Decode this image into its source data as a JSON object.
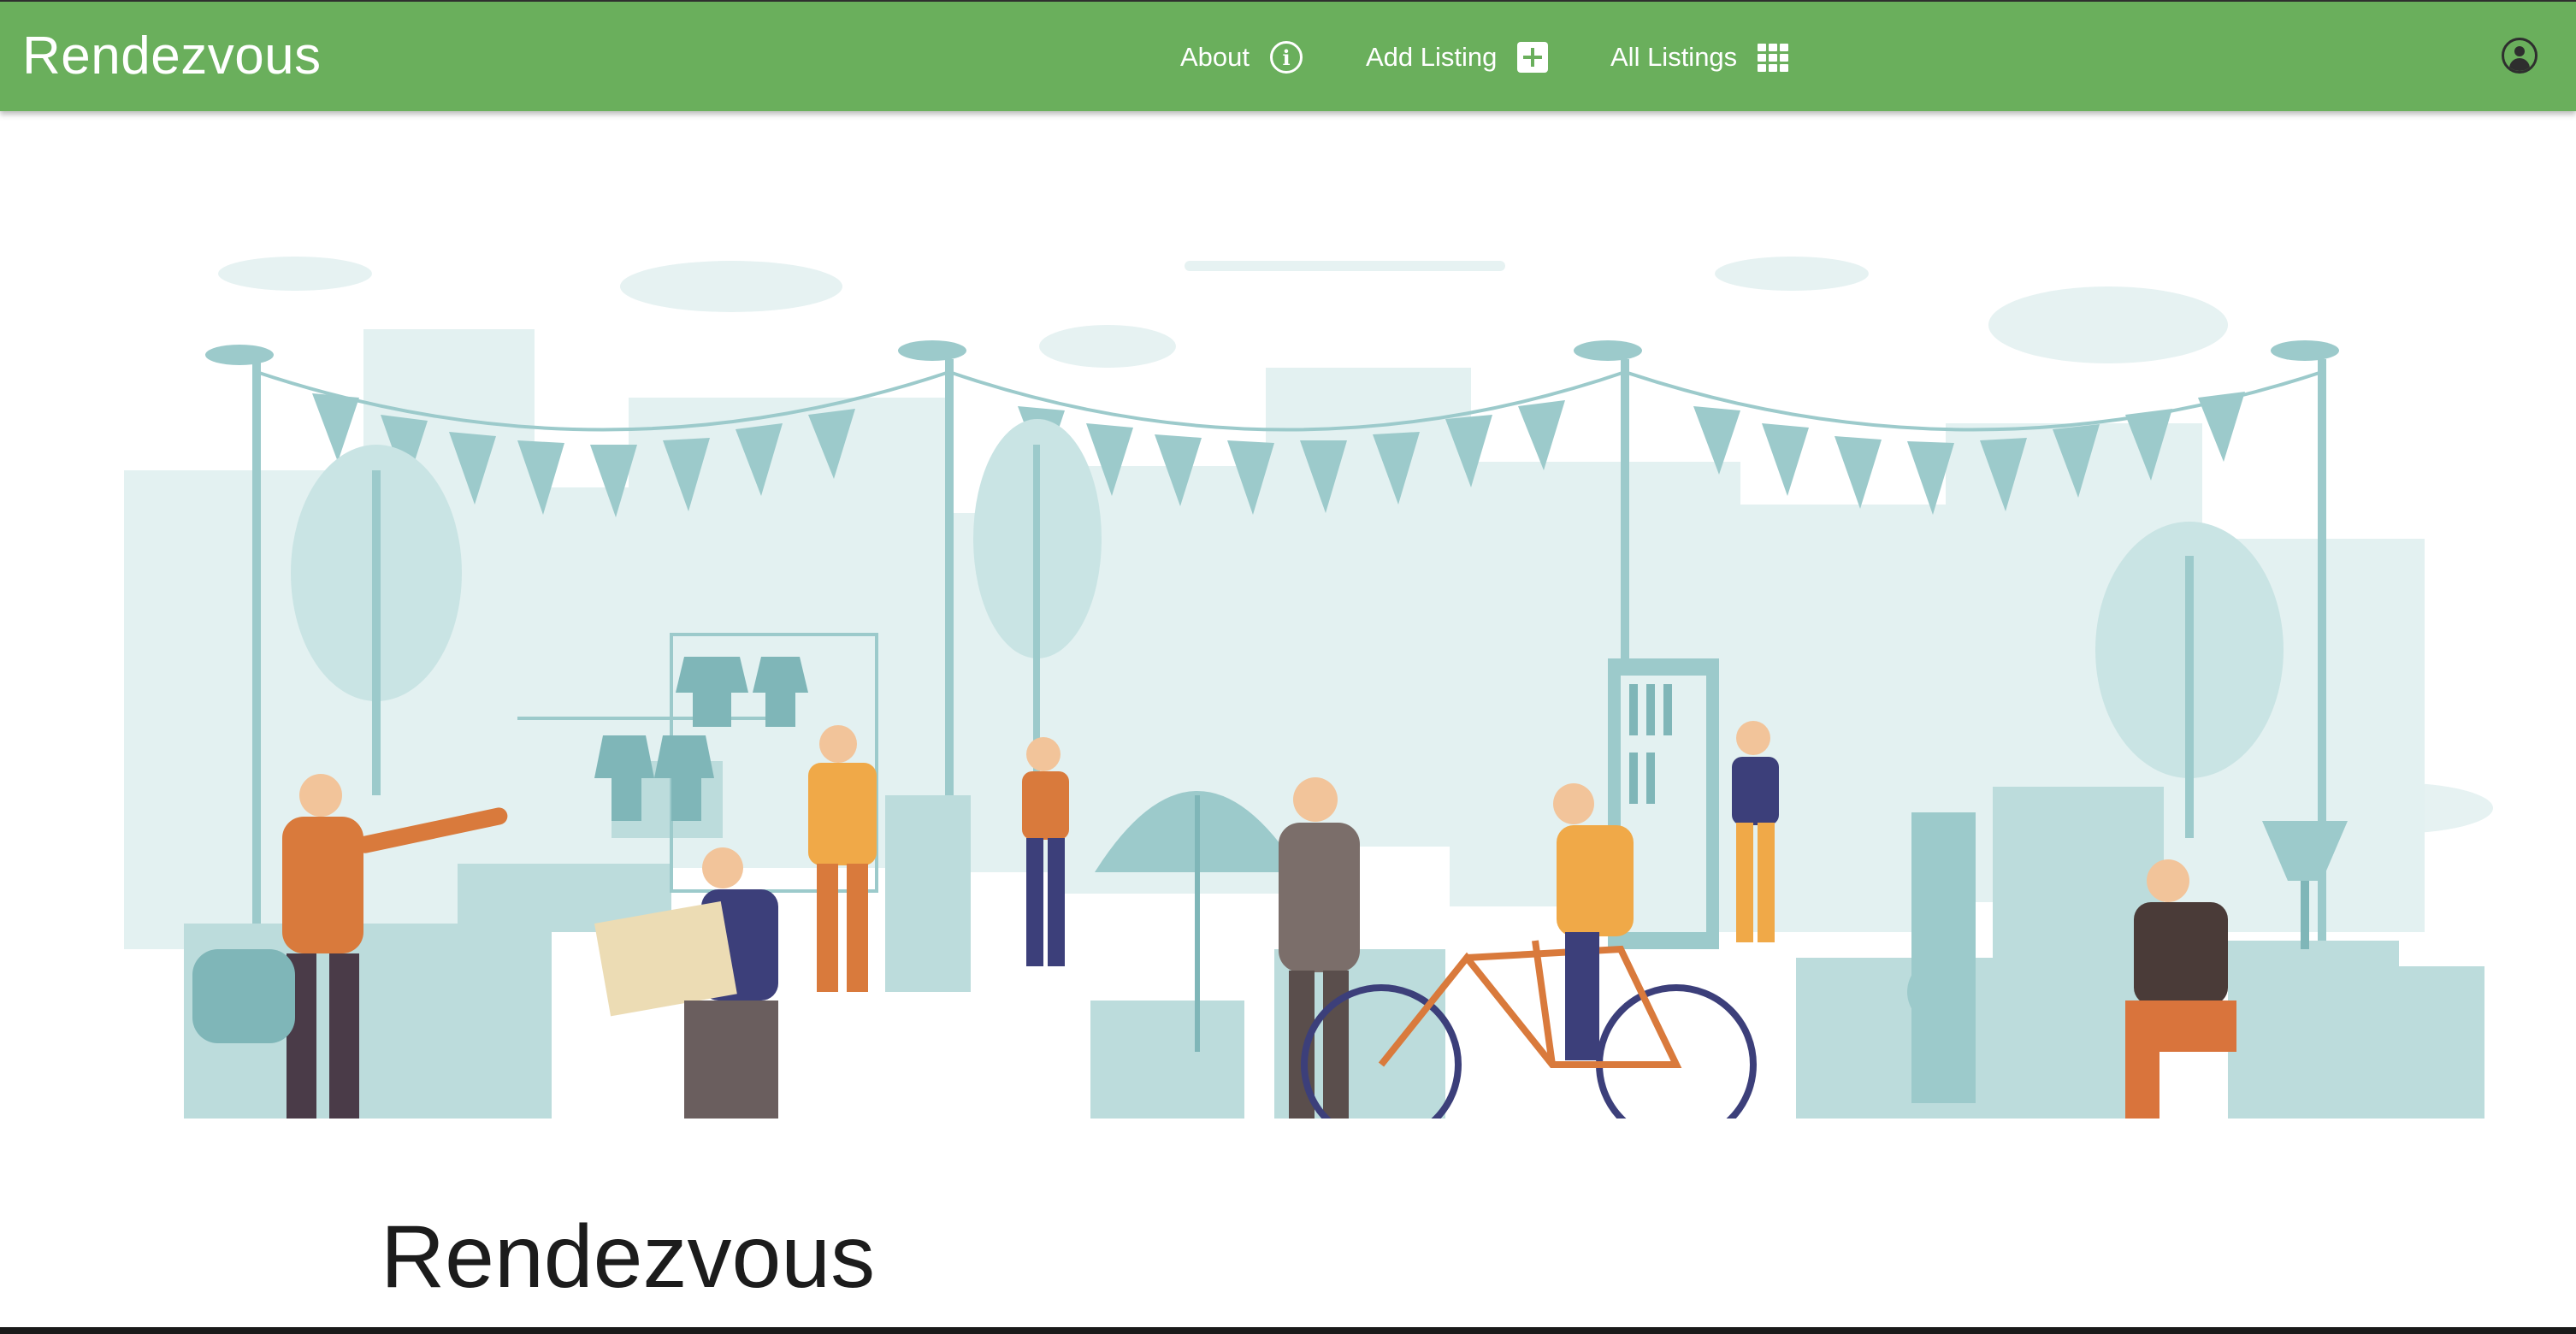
{
  "header": {
    "brand": "Rendezvous",
    "nav": {
      "about_label": "About",
      "add_listing_label": "Add Listing",
      "all_listings_label": "All Listings"
    },
    "icons": {
      "about": "info-icon",
      "add_listing": "plus-square-icon",
      "all_listings": "grid-icon",
      "account": "user-account-icon"
    },
    "colors": {
      "bar": "#6aaf5c",
      "text": "#ffffff"
    }
  },
  "hero": {
    "illustration": "flea-market-illustration",
    "colors": {
      "teal": "#9ccacb",
      "light_teal": "#e3f1f1",
      "orange": "#d97a3c",
      "navy": "#3c3f7a"
    }
  },
  "main": {
    "title": "Rendezvous"
  }
}
